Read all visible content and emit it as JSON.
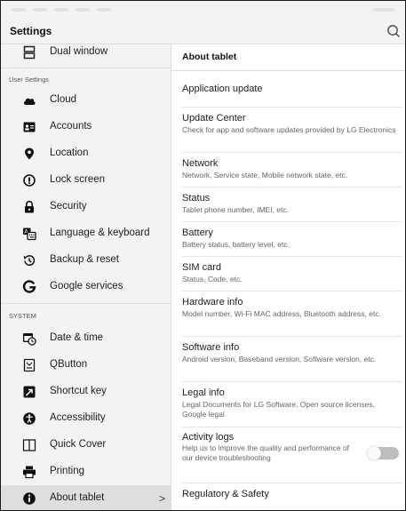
{
  "app_title": "Settings",
  "sidebar": {
    "top_item": {
      "label": "Dual window",
      "icon": "dual-window-icon"
    },
    "sections": [
      {
        "header": "User Settings",
        "items": [
          {
            "label": "Cloud",
            "icon": "cloud-icon"
          },
          {
            "label": "Accounts",
            "icon": "accounts-icon"
          },
          {
            "label": "Location",
            "icon": "location-icon"
          },
          {
            "label": "Lock screen",
            "icon": "lock-screen-icon"
          },
          {
            "label": "Security",
            "icon": "security-lock-icon"
          },
          {
            "label": "Language & keyboard",
            "icon": "language-keyboard-icon"
          },
          {
            "label": "Backup & reset",
            "icon": "backup-reset-icon"
          },
          {
            "label": "Google services",
            "icon": "google-icon"
          }
        ]
      },
      {
        "header": "SYSTEM",
        "items": [
          {
            "label": "Date & time",
            "icon": "date-time-icon"
          },
          {
            "label": "QButton",
            "icon": "qbutton-icon"
          },
          {
            "label": "Shortcut key",
            "icon": "shortcut-key-icon"
          },
          {
            "label": "Accessibility",
            "icon": "accessibility-icon"
          },
          {
            "label": "Quick Cover",
            "icon": "quick-cover-icon"
          },
          {
            "label": "Printing",
            "icon": "printer-icon"
          },
          {
            "label": "About tablet",
            "icon": "info-icon",
            "selected": true,
            "chevron": ">"
          }
        ]
      }
    ]
  },
  "detail": {
    "header": "About tablet",
    "items": [
      {
        "title": "Application update",
        "desc": ""
      },
      {
        "title": "Update Center",
        "desc": "Check for app and software updates provided by LG Electronics"
      },
      {
        "title": "Network",
        "desc": "Network, Service state, Mobile network state, etc."
      },
      {
        "title": "Status",
        "desc": "Tablet phone number, IMEI, etc."
      },
      {
        "title": "Battery",
        "desc": "Battery status, battery level, etc."
      },
      {
        "title": "SIM card",
        "desc": "Status, Code, etc."
      },
      {
        "title": "Hardware info",
        "desc": "Model number, Wi-Fi MAC address, Bluetooth address, etc."
      },
      {
        "title": "Software info",
        "desc": "Android version, Baseband version, Software version, etc."
      },
      {
        "title": "Legal info",
        "desc": "Legal Documents for LG Software, Open source licenses, Google legal"
      },
      {
        "title": "Activity logs",
        "desc": "Help us to improve the quality and performance of our device troubleshooting",
        "toggle": false
      },
      {
        "title": "Regulatory & Safety",
        "desc": ""
      }
    ]
  },
  "colors": {
    "sidebar_bg": "#f3f3f3",
    "selected_bg": "#dedede",
    "divider": "#dcdcdc",
    "toggle_track": "#bdbdbd"
  }
}
